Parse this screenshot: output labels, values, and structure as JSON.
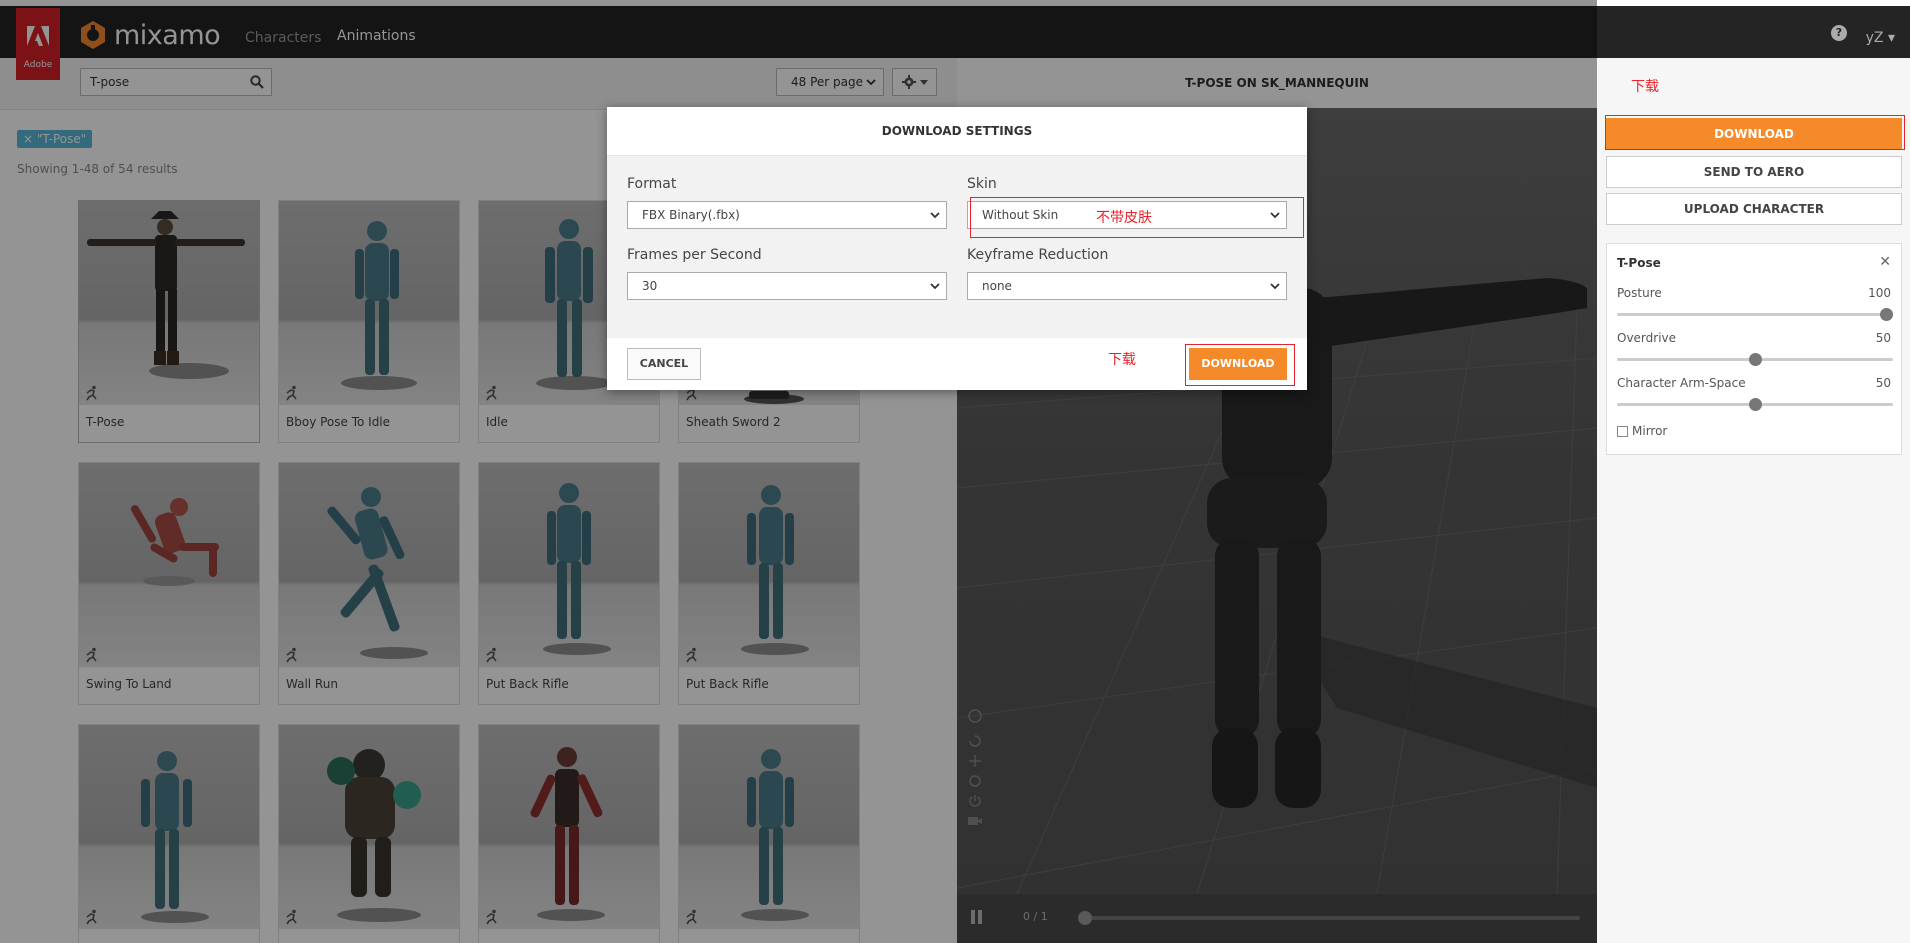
{
  "adobe": {
    "label": "Adobe"
  },
  "brand": {
    "name": "mixamo"
  },
  "nav": {
    "characters": "Characters",
    "animations": "Animations",
    "help": "?",
    "user": "yZ ▾"
  },
  "search": {
    "value": "T-pose",
    "placeholder": "Search"
  },
  "perpage": {
    "label": "48 Per page"
  },
  "filter_tag": "× \"T-Pose\"",
  "results": "Showing 1-48 of 54 results",
  "cards": [
    {
      "name": "T-Pose"
    },
    {
      "name": "Bboy Pose To Idle"
    },
    {
      "name": "Idle"
    },
    {
      "name": "Sheath Sword 2"
    },
    {
      "name": "Swing To Land"
    },
    {
      "name": "Wall Run"
    },
    {
      "name": "Put Back Rifle"
    },
    {
      "name": "Put Back Rifle"
    },
    {
      "name": ""
    },
    {
      "name": ""
    },
    {
      "name": ""
    },
    {
      "name": ""
    }
  ],
  "viewer": {
    "title": "T-POSE ON SK_MANNEQUIN",
    "frame": "0 / 1"
  },
  "sidebar": {
    "download": "DOWNLOAD",
    "send_to_aero": "SEND TO AERO",
    "upload": "UPLOAD CHARACTER",
    "panel_title": "T-Pose",
    "close": "✕",
    "sliders": [
      {
        "label": "Posture",
        "value": "100",
        "level": 1.0
      },
      {
        "label": "Overdrive",
        "value": "50",
        "level": 0.5
      },
      {
        "label": "Character Arm-Space",
        "value": "50",
        "level": 0.5
      }
    ],
    "mirror": "Mirror"
  },
  "modal": {
    "title": "DOWNLOAD SETTINGS",
    "format_label": "Format",
    "format_value": "FBX Binary(.fbx)",
    "skin_label": "Skin",
    "skin_value": "Without Skin",
    "fps_label": "Frames per Second",
    "fps_value": "30",
    "keyframe_label": "Keyframe Reduction",
    "keyframe_value": "none",
    "cancel": "CANCEL",
    "download": "DOWNLOAD"
  },
  "annotations": {
    "skin_note": "不带皮肤",
    "dl_note": "下载",
    "top_note": "下载"
  },
  "colors": {
    "accent": "#f58a2a",
    "annotation": "#e8232a",
    "nav_bg": "#242424",
    "adobe_red": "#d81f26"
  }
}
